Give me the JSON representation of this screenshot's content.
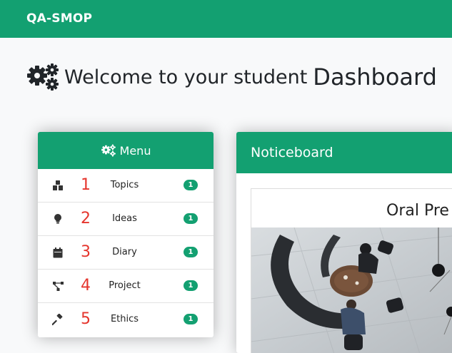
{
  "brand": "QA-SMOP",
  "heading": {
    "prefix": "Welcome to your student",
    "emphasis": "Dashboard",
    "icon": "gears-icon"
  },
  "menu": {
    "title": "Menu",
    "icon": "cogs-icon",
    "items": [
      {
        "number": "1",
        "label": "Topics",
        "badge": "1",
        "icon": "cubes-icon"
      },
      {
        "number": "2",
        "label": "Ideas",
        "badge": "1",
        "icon": "lightbulb-icon"
      },
      {
        "number": "3",
        "label": "Diary",
        "badge": "1",
        "icon": "calendar-icon"
      },
      {
        "number": "4",
        "label": "Project",
        "badge": "1",
        "icon": "project-diagram-icon"
      },
      {
        "number": "5",
        "label": "Ethics",
        "badge": "1",
        "icon": "gavel-icon"
      }
    ]
  },
  "noticeboard": {
    "title": "Noticeboard",
    "post_title": "Oral Pre"
  },
  "colors": {
    "primary": "#13a071",
    "number_red": "#e5352d",
    "background": "#f8f9fa"
  }
}
